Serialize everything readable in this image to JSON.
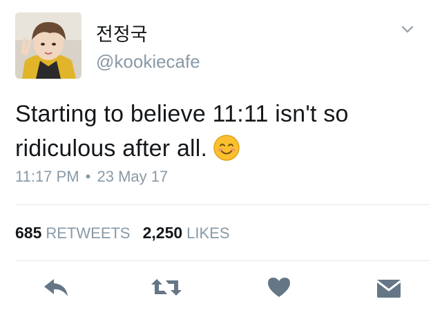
{
  "user": {
    "display_name": "전정국",
    "handle": "@kookiecafe"
  },
  "tweet": {
    "text": "Starting to believe 11:11 isn't so ridiculous after all.",
    "emoji": "smiling-face-emoji",
    "time": "11:17 PM",
    "separator": "•",
    "date": "23 May 17"
  },
  "stats": {
    "retweets_count": "685",
    "retweets_label": "RETWEETS",
    "likes_count": "2,250",
    "likes_label": "LIKES"
  },
  "icons": {
    "menu": "chevron-down-icon",
    "reply": "reply-icon",
    "retweet": "retweet-icon",
    "like": "heart-icon",
    "dm": "envelope-icon"
  },
  "colors": {
    "text": "#14171a",
    "secondary": "#8899a6",
    "icon": "#657786",
    "divider": "#e1e8ed"
  }
}
